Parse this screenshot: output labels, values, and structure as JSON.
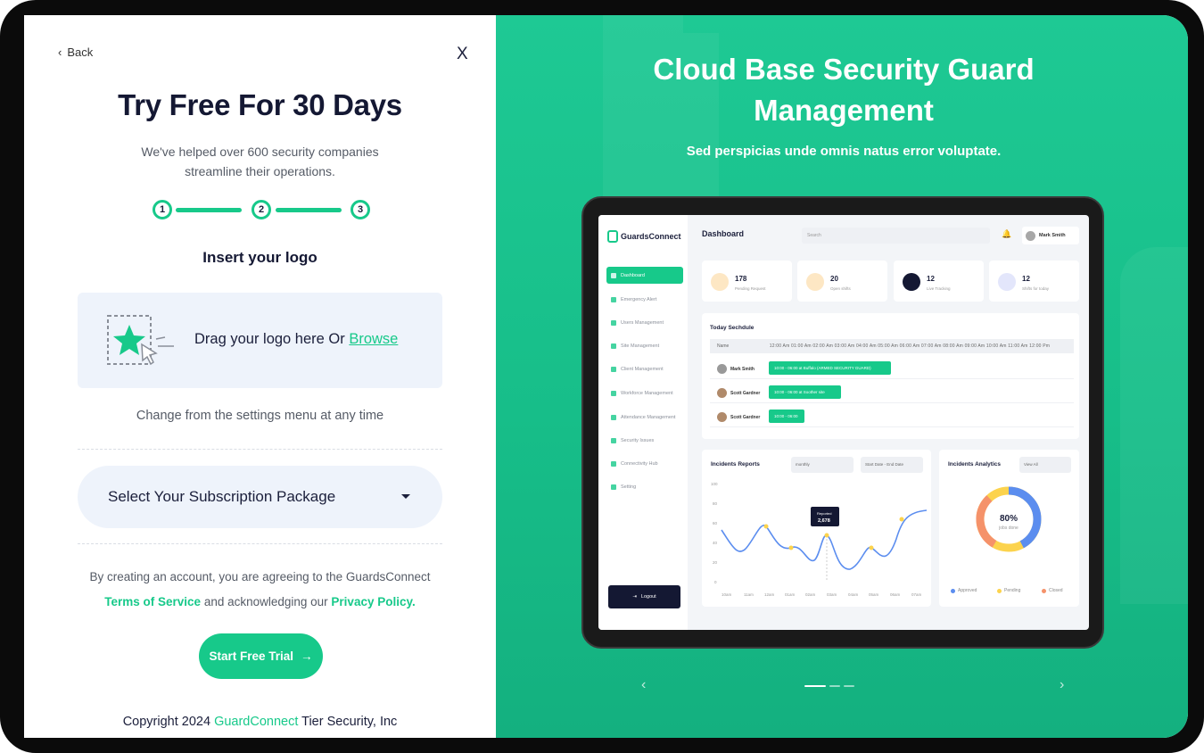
{
  "left": {
    "back_label": "Back",
    "close_label": "X",
    "title": "Try Free For 30 Days",
    "subtitle": "We've helped over 600 security companies streamline their operations.",
    "steps": [
      "1",
      "2",
      "3"
    ],
    "logo_label": "Insert your logo",
    "dropzone": {
      "text": "Drag your logo here Or ",
      "browse": "Browse",
      "icon": "star-upload-icon"
    },
    "change_note": "Change from the settings menu at any time",
    "subscription_select": "Select Your Subscription Package",
    "terms": {
      "line1": "By creating an account, you are agreeing to the GuardsConnect",
      "tos": "Terms of Service",
      "mid": " and acknowledging our ",
      "privacy": "Privacy Policy."
    },
    "cta_label": "Start Free Trial",
    "copyright": {
      "prefix": "Copyright 2024 ",
      "brand": "GuardConnect",
      "suffix": " Tier Security, Inc"
    }
  },
  "right": {
    "hero_title_line1": "Cloud Base Security Guard",
    "hero_title_line2": "Management",
    "hero_subtitle": "Sed perspicias unde omnis natus error voluptate.",
    "carousel": {
      "prev": "‹",
      "next": "›",
      "slides": 3,
      "active": 0
    }
  },
  "app": {
    "brand": "GuardsConnect",
    "header_title": "Dashboard",
    "search_placeholder": "Search",
    "user_name": "Mark Smith",
    "nav": [
      "Dashboard",
      "Emergency Alert",
      "Users Management",
      "Site Management",
      "Client Management",
      "Workforce Management",
      "Attendance Management",
      "Security Issues",
      "Connectivity Hub",
      "Setting"
    ],
    "logout": "Logout",
    "stats": [
      {
        "value": "178",
        "label": "Pending Request",
        "color": "#fde7c4"
      },
      {
        "value": "20",
        "label": "Open shifts",
        "color": "#fde7c4"
      },
      {
        "value": "12",
        "label": "Live Tracking",
        "color": "#141833"
      },
      {
        "value": "12",
        "label": "Shifts for today",
        "color": "#e3e6fb"
      }
    ],
    "schedule": {
      "title": "Today Sechdule",
      "head": "Name",
      "times": [
        "12:00 Am",
        "01:00 Am",
        "02:00 Am",
        "03:00 Am",
        "04:00 Am",
        "05:00 Am",
        "06:00 Am",
        "07:00 Am",
        "08:00 Am",
        "09:00 Am",
        "10:00 Am",
        "11:00 Am",
        "12:00 Pm"
      ],
      "rows": [
        {
          "name": "Mark Smith",
          "shift": "10:00 - 06:00 at Buffalo (ARMED SECURITY GUARD)"
        },
        {
          "name": "Scott Gardner",
          "shift": "10:00 - 06:00 at Soother site"
        },
        {
          "name": "Scott Gardner",
          "shift": "10:00 - 06:00"
        }
      ]
    },
    "incidents": {
      "title": "Incidents Reports",
      "period": "monthly",
      "range": "Start Date - End Date",
      "tooltip_label": "Reported",
      "tooltip_value": "2,678",
      "y_ticks": [
        "100",
        "80",
        "60",
        "40",
        "20",
        "0"
      ],
      "x_ticks": [
        "10am",
        "11am",
        "12am",
        "01am",
        "02am",
        "03am",
        "04am",
        "05am",
        "06am",
        "07am"
      ]
    },
    "analytics": {
      "title": "Incidents Analytics",
      "filter": "View All",
      "center_value": "80%",
      "center_label": "jobs done",
      "legend": [
        {
          "label": "Approved",
          "color": "#5b8def"
        },
        {
          "label": "Pending",
          "color": "#fcd34d"
        },
        {
          "label": "Closed",
          "color": "#f5926a"
        }
      ]
    }
  },
  "colors": {
    "accent": "#17c98a",
    "navy": "#141833"
  }
}
